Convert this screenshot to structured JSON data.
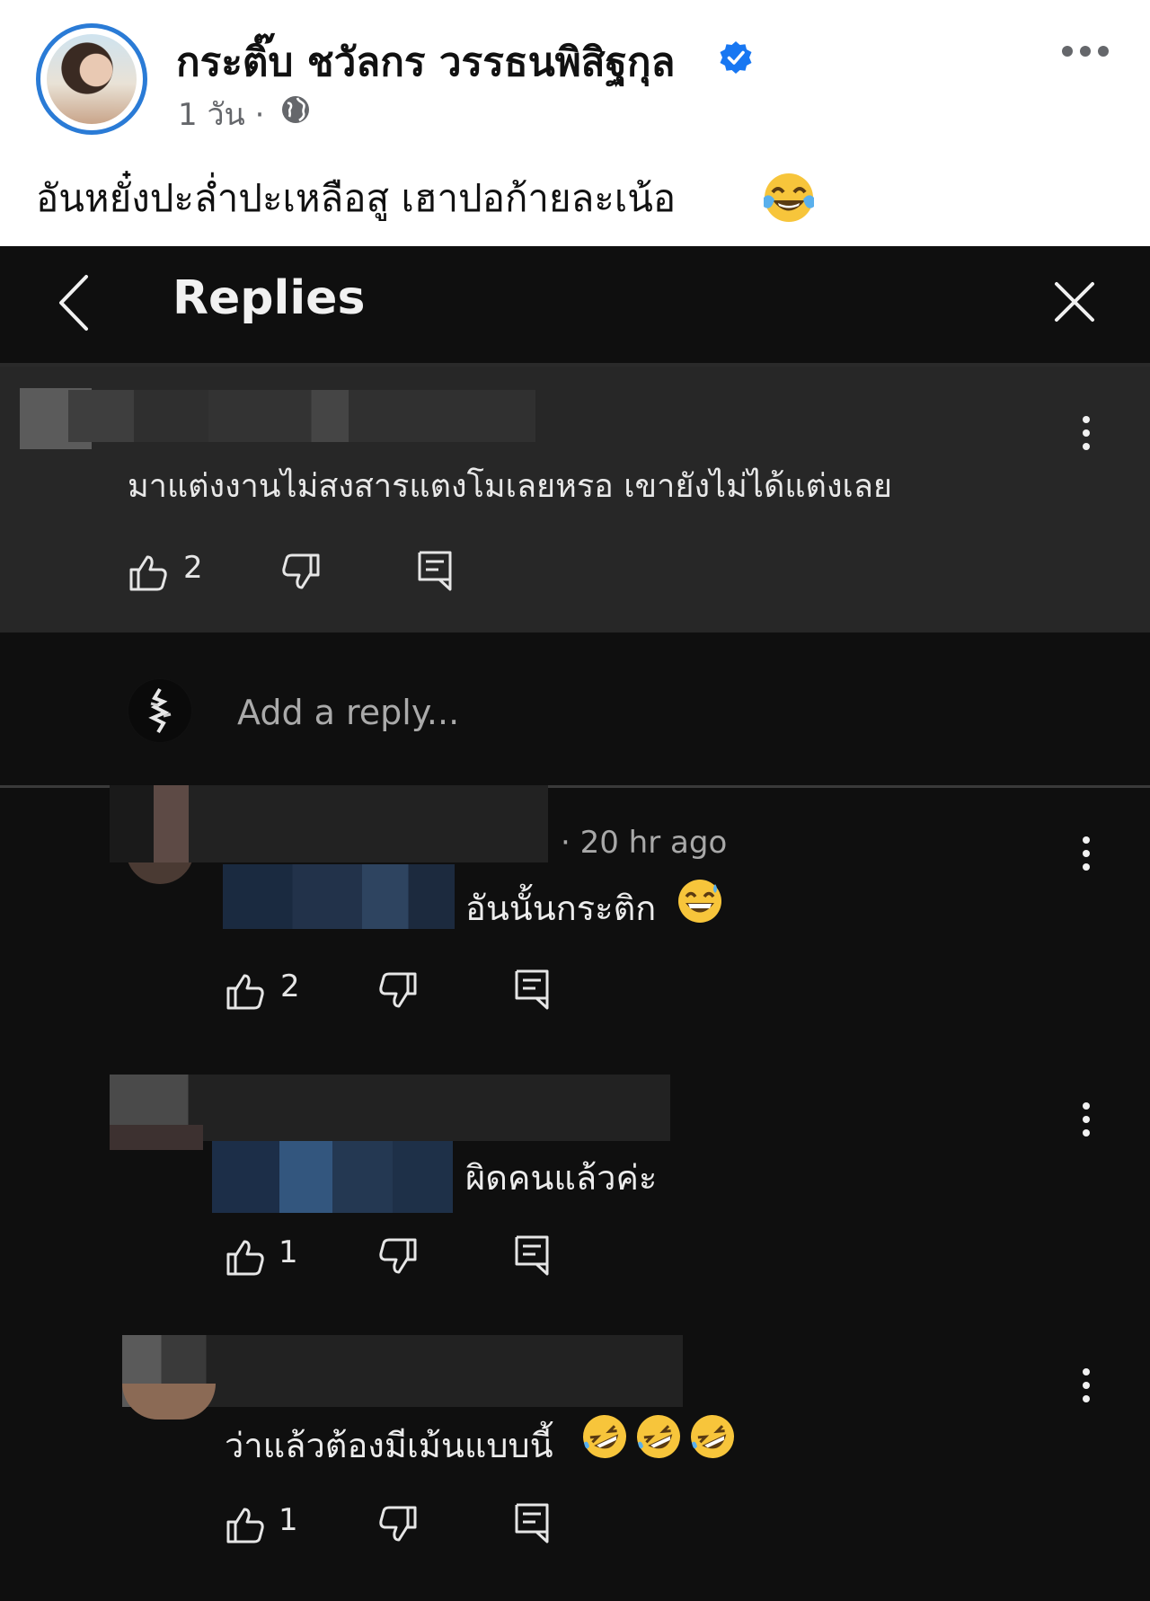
{
  "post": {
    "author": "กระติ๊บ ชวัลกร วรรธนพิสิฐกุล",
    "time": "1 วัน ·",
    "text": "อันหยั๋งปะล่ำปะเหลือสู เฮาปอก้ายละเน้อ",
    "emoji": "face-with-tears-of-joy",
    "verified": true
  },
  "replies_panel": {
    "title": "Replies",
    "parent_comment": {
      "text": "มาแต่งงานไม่สงสารแตงโมเลยหรอ เขายังไม่ได้แต่งเลย",
      "likes": "2"
    },
    "reply_input": {
      "placeholder": "Add a reply..."
    },
    "replies": [
      {
        "time": "· 20 hr ago",
        "text": "อันนั้นกระติก",
        "emoji": "grinning-sweat",
        "likes": "2"
      },
      {
        "text": "ผิดคนแล้วค่ะ",
        "likes": "1"
      },
      {
        "text": "ว่าแล้วต้องมีเม้นแบบนี้",
        "emoji": "rolling-on-floor-laughing",
        "emoji_count": 3,
        "likes": "1"
      }
    ]
  },
  "colors": {
    "facebook_verified": "#1877f2",
    "avatar_ring": "#2a7bd6",
    "dark_bg": "#0f0f0f",
    "parent_bg": "#272727"
  }
}
